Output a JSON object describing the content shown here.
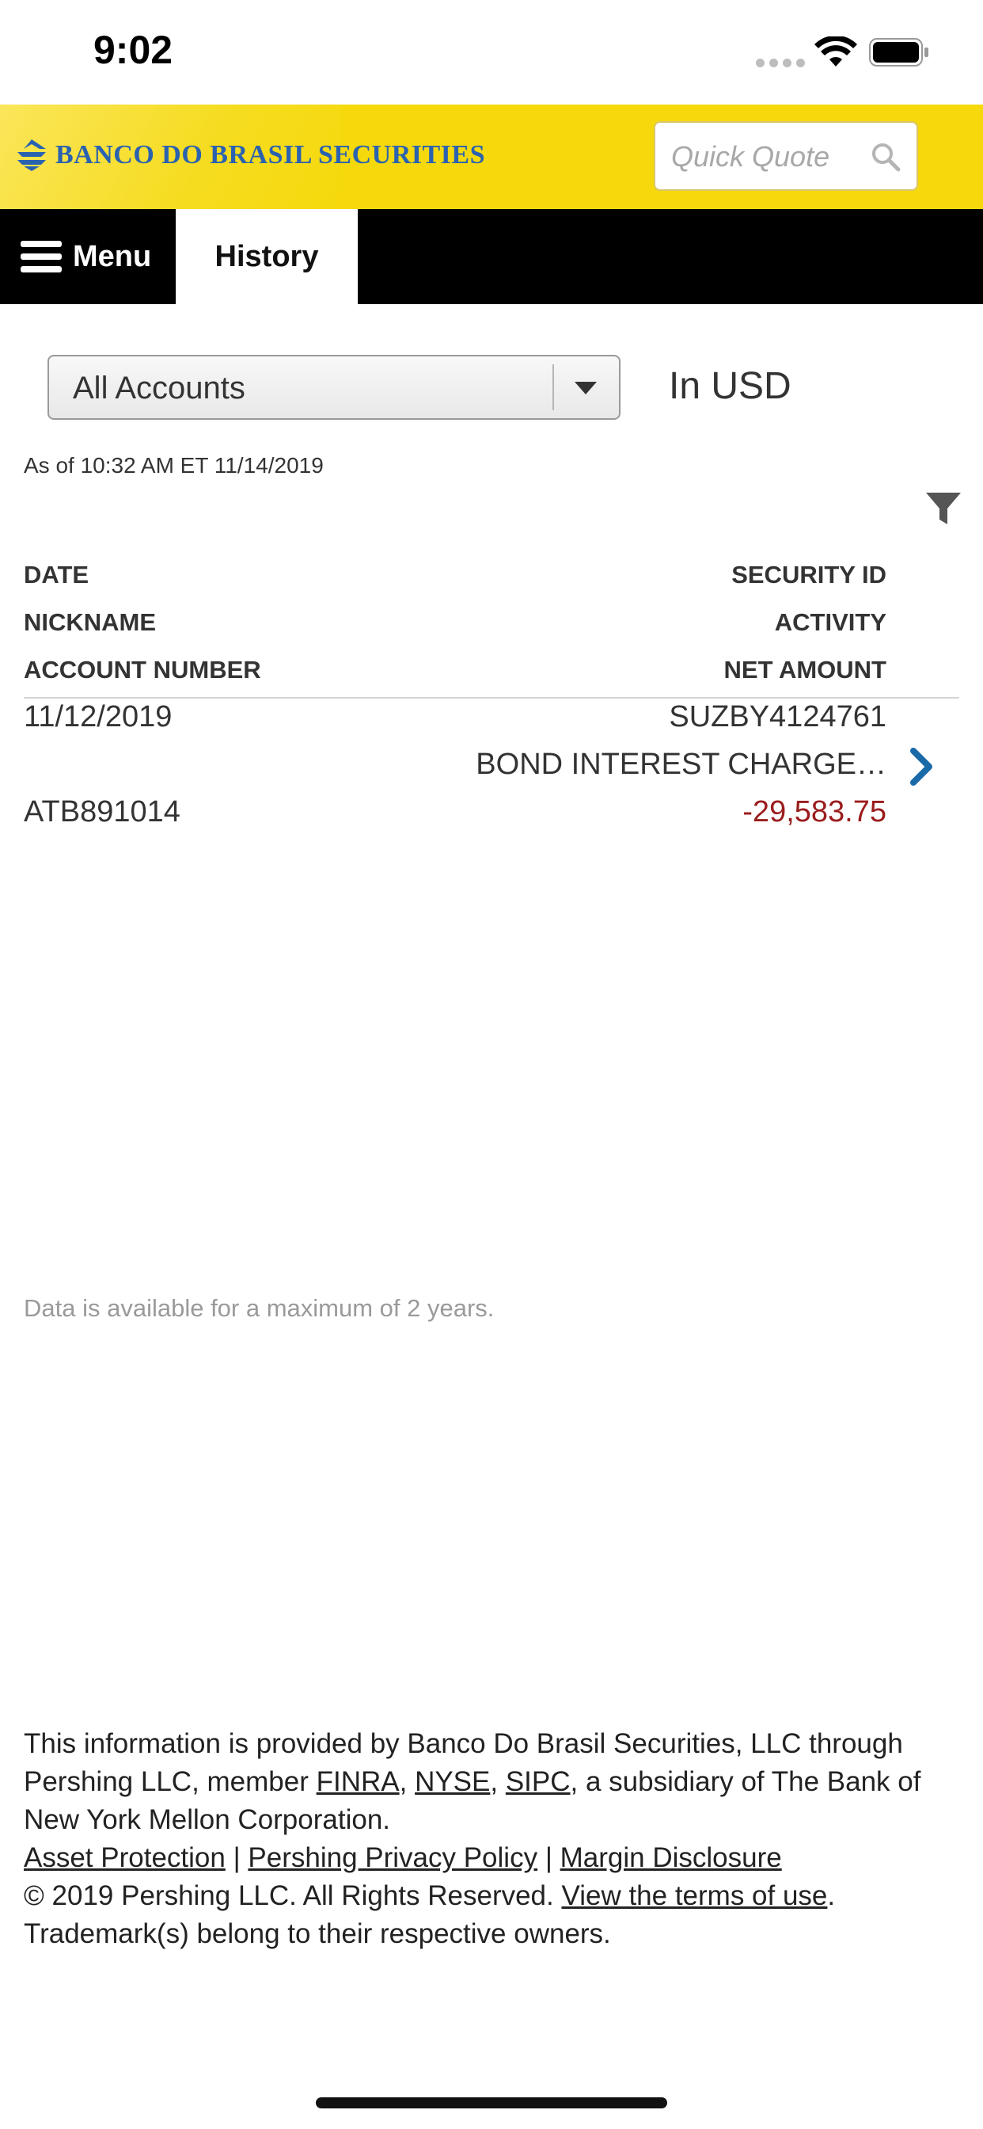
{
  "status_bar": {
    "time": "9:02"
  },
  "header": {
    "brand_name": "BANCO DO BRASIL SECURITIES",
    "quick_quote_placeholder": "Quick Quote"
  },
  "nav": {
    "menu_label": "Menu",
    "active_tab": "History"
  },
  "filters": {
    "account_selected": "All Accounts",
    "currency": "In USD",
    "as_of": "As of 10:32 AM ET 11/14/2019"
  },
  "columns": {
    "date": "DATE",
    "security_id": "SECURITY ID",
    "nickname": "NICKNAME",
    "activity": "ACTIVITY",
    "account_number": "ACCOUNT NUMBER",
    "net_amount": "NET AMOUNT"
  },
  "rows": [
    {
      "date": "11/12/2019",
      "security_id": "SUZBY4124761",
      "activity": "BOND INTEREST CHARGE…",
      "account_number": "ATB891014",
      "net_amount": "-29,583.75"
    }
  ],
  "notes": {
    "availability": "Data is available for a maximum of 2 years."
  },
  "footer": {
    "intro": "This information is provided by Banco Do Brasil Securities, LLC through Pershing LLC, member ",
    "finra": "FINRA",
    "sep1": ", ",
    "nyse": "NYSE",
    "sep2": ", ",
    "sipc": "SIPC",
    "tail": ", a subsidiary of The Bank of New York Mellon Corporation.",
    "asset_protection": "Asset Protection",
    "pipe": " | ",
    "privacy_policy": "Pershing Privacy Policy",
    "margin_disclosure": "Margin Disclosure",
    "copyright": "© 2019 Pershing LLC. All Rights Reserved. ",
    "terms_link": "View the terms of use",
    "period": ".",
    "trademark": "Trademark(s) belong to their respective owners."
  },
  "colors": {
    "brand_yellow": "#f5d90d",
    "brand_blue": "#2a62b0",
    "negative_amount": "#9b1c1c",
    "chevron_blue": "#1a6aa8"
  }
}
